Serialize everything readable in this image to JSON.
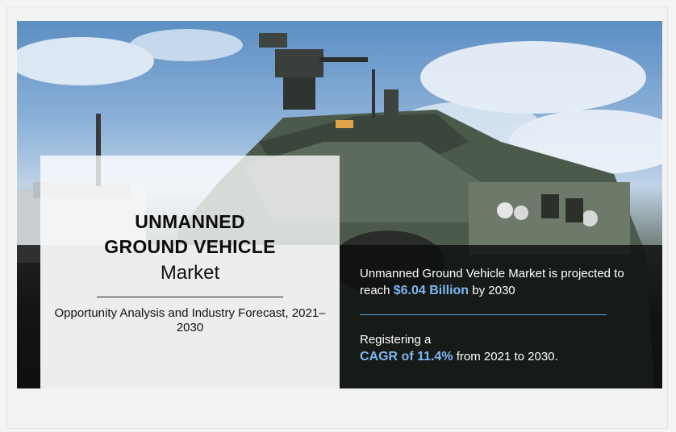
{
  "banner": {
    "title_line1": "UNMANNED",
    "title_line2": "GROUND VEHICLE",
    "title_line3": "Market",
    "subtitle": "Opportunity Analysis and Industry Forecast, 2021–2030",
    "projection_prefix": "Unmanned Ground Vehicle Market is projected to reach ",
    "projection_value": "$6.04 Billion",
    "projection_suffix": " by 2030",
    "cagr_prefix": "Registering a",
    "cagr_value": "CAGR of 11.4%",
    "cagr_suffix": " from 2021 to 2030."
  },
  "colors": {
    "highlight": "#7db8f2",
    "separator": "#5b9ad8",
    "band": "#0c0e0d"
  }
}
